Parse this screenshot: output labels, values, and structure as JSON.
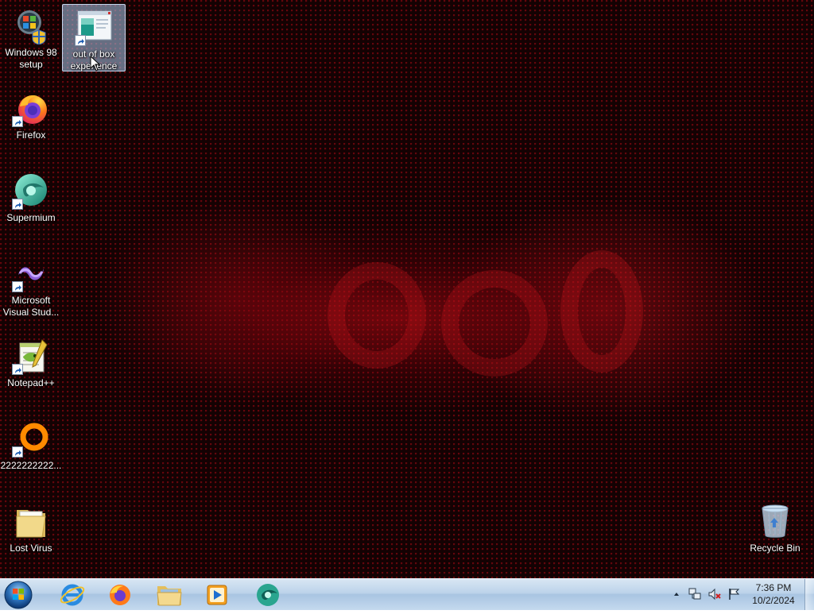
{
  "desktop": {
    "icons": [
      {
        "label": "Windows 98 setup",
        "icon": "windows-setup-icon"
      },
      {
        "label": "out of box experience",
        "icon": "oobe-window-icon"
      },
      {
        "label": "Firefox",
        "icon": "firefox-icon"
      },
      {
        "label": "Supermium",
        "icon": "supermium-icon"
      },
      {
        "label": "Microsoft Visual Stud...",
        "icon": "visual-studio-icon"
      },
      {
        "label": "Notepad++",
        "icon": "notepad-plus-plus-icon"
      },
      {
        "label": "2222222222...",
        "icon": "orange-ring-icon"
      },
      {
        "label": "Lost Virus",
        "icon": "folder-icon"
      },
      {
        "label": "Recycle Bin",
        "icon": "recycle-bin-icon"
      }
    ],
    "selected_icon": "out of box experience"
  },
  "taskbar": {
    "start": "start-orb-icon",
    "pinned": [
      {
        "name": "Internet Explorer",
        "icon": "internet-explorer-icon"
      },
      {
        "name": "Firefox",
        "icon": "firefox-icon"
      },
      {
        "name": "Windows Explorer",
        "icon": "file-explorer-icon"
      },
      {
        "name": "Windows Media Player",
        "icon": "media-player-icon"
      },
      {
        "name": "Supermium",
        "icon": "supermium-icon"
      }
    ],
    "tray": {
      "icons": [
        "show-hidden-icons-chevron",
        "network-icon",
        "volume-muted-icon",
        "action-center-flag-icon"
      ],
      "time": "7:36 PM",
      "date": "10/2/2024"
    }
  },
  "colors": {
    "wallpaper_base": "#140203",
    "wallpaper_accent": "#c0141e",
    "taskbar": "#bcd3ea",
    "selection": "#aac8eb"
  }
}
